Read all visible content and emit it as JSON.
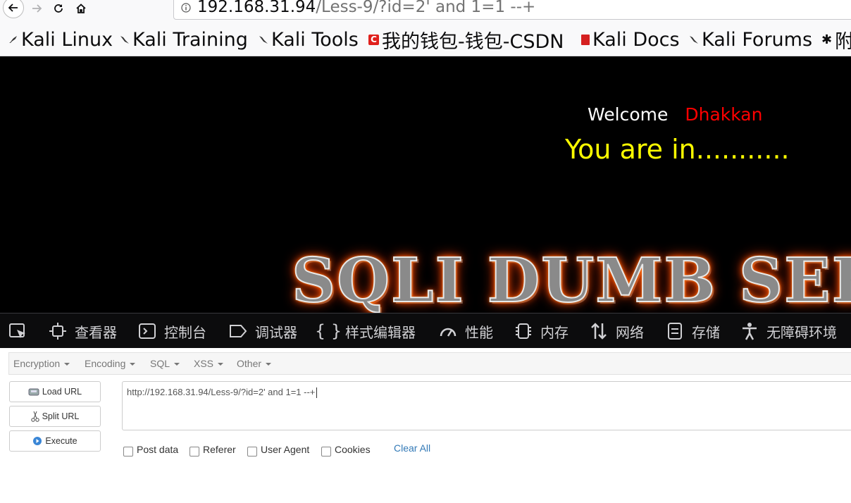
{
  "browser": {
    "url_host": "192.168.31.94",
    "url_path": "/Less-9/?id=2' and 1=1 --+"
  },
  "bookmarks": [
    {
      "label": "Kali Linux",
      "icon": "kali-dragon-icon"
    },
    {
      "label": "Kali Training",
      "icon": "kali-dragon-icon"
    },
    {
      "label": "Kali Tools",
      "icon": "kali-dragon-icon"
    },
    {
      "label": "我的钱包-钱包-CSDN",
      "icon": "csdn-icon"
    },
    {
      "label": "Kali Docs",
      "icon": "kali-docs-icon"
    },
    {
      "label": "Kali Forums",
      "icon": "kali-dragon-icon"
    },
    {
      "label": "附",
      "icon": "puzzle-icon"
    }
  ],
  "page": {
    "welcome_label": "Welcome",
    "welcome_name": "Dhakkan",
    "result_message": "You are in...........",
    "banner_text": "SQLI DUMB SER",
    "colors": {
      "background": "#000000",
      "welcome": "#ffffff",
      "name": "#ff0000",
      "result": "#ffff00"
    }
  },
  "devtools": {
    "tabs": [
      {
        "label": "查看器",
        "icon": "inspector-icon"
      },
      {
        "label": "控制台",
        "icon": "console-icon"
      },
      {
        "label": "调试器",
        "icon": "debugger-icon"
      },
      {
        "label": "样式编辑器",
        "icon": "style-editor-icon"
      },
      {
        "label": "性能",
        "icon": "performance-icon"
      },
      {
        "label": "内存",
        "icon": "memory-icon"
      },
      {
        "label": "网络",
        "icon": "network-icon"
      },
      {
        "label": "存储",
        "icon": "storage-icon"
      },
      {
        "label": "无障碍环境",
        "icon": "accessibility-icon"
      }
    ]
  },
  "hackbar": {
    "menu": [
      "Encryption",
      "Encoding",
      "SQL",
      "XSS",
      "Other"
    ],
    "buttons": {
      "load": "Load URL",
      "split": "Split URL",
      "execute": "Execute"
    },
    "url_value": "http://192.168.31.94/Less-9/?id=2' and 1=1 --+",
    "checkboxes": [
      "Post data",
      "Referer",
      "User Agent",
      "Cookies"
    ],
    "clear_all": "Clear All"
  }
}
